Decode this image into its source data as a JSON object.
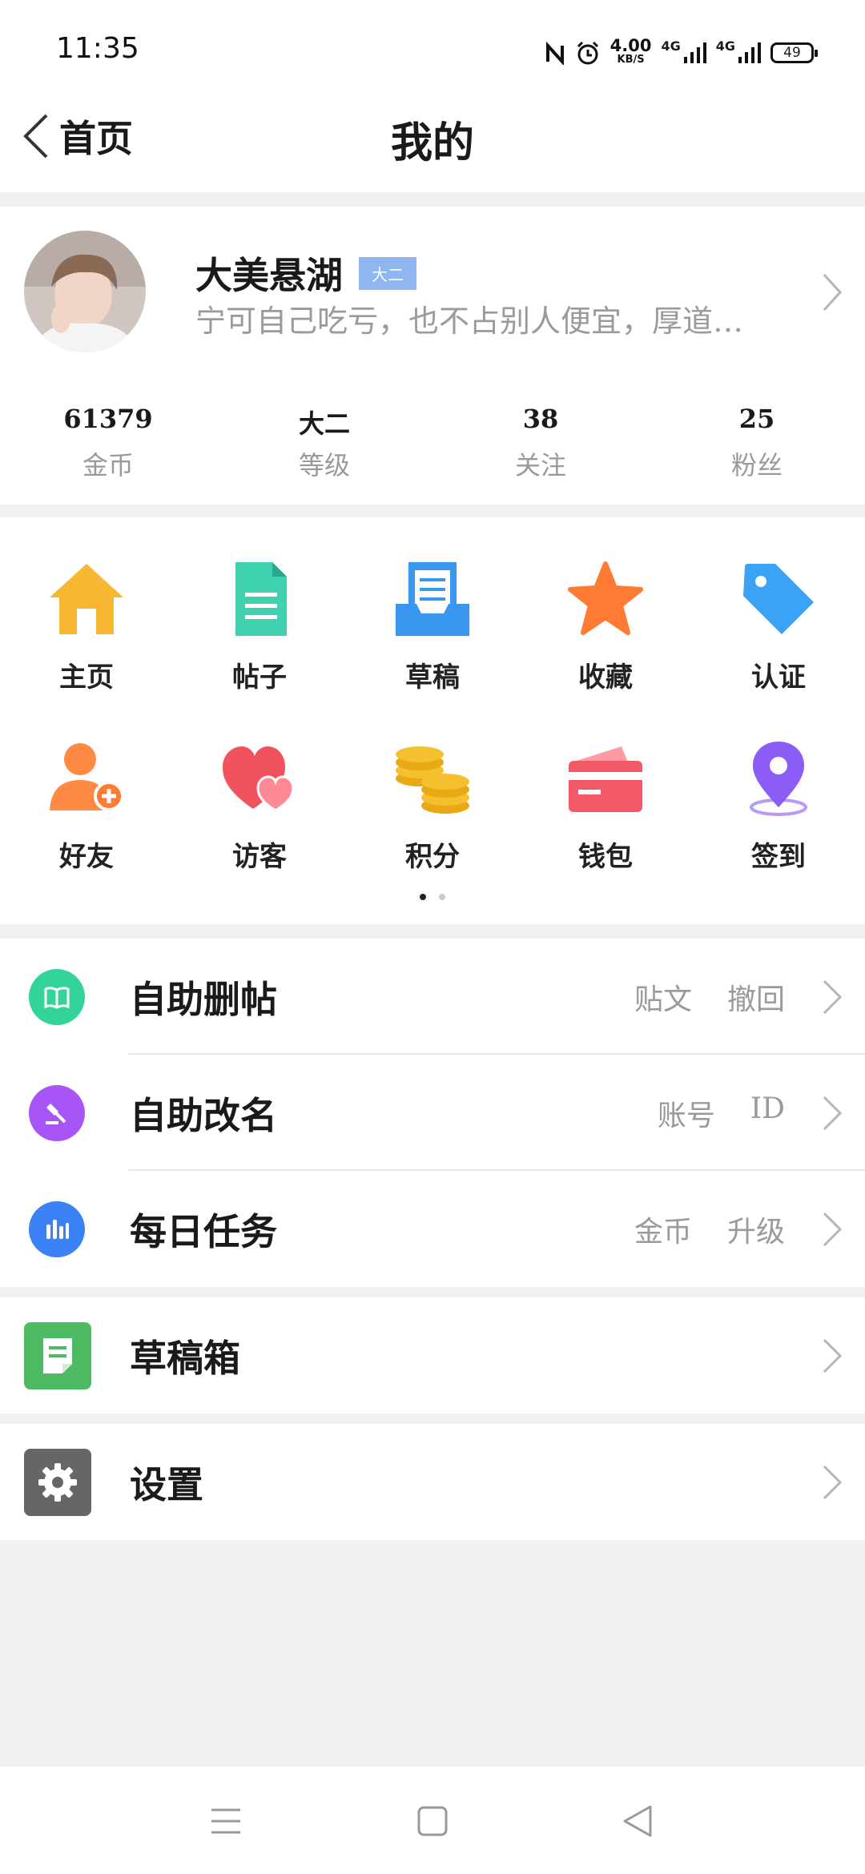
{
  "status_bar": {
    "time": "11:35",
    "speed_value": "4.00",
    "speed_unit": "KB/S",
    "network_1": "4G",
    "network_2": "4G",
    "battery": "49",
    "icons": [
      "nfc-icon",
      "alarm-icon",
      "signal-icon",
      "signal-icon",
      "battery-icon"
    ]
  },
  "header": {
    "back_label": "首页",
    "title": "我的"
  },
  "profile": {
    "name": "大美悬湖",
    "level_badge": "大二",
    "signature": "宁可自己吃亏，也不占别人便宜，厚道…",
    "stats": [
      {
        "value": "61379",
        "label": "金币"
      },
      {
        "value": "大二",
        "label": "等级"
      },
      {
        "value": "38",
        "label": "关注"
      },
      {
        "value": "25",
        "label": "粉丝"
      }
    ]
  },
  "grid": {
    "row1": [
      {
        "label": "主页",
        "icon": "home-icon",
        "color": "#f7b731"
      },
      {
        "label": "帖子",
        "icon": "document-icon",
        "color": "#3fd1b0"
      },
      {
        "label": "草稿",
        "icon": "draft-tray-icon",
        "color": "#3a97f0"
      },
      {
        "label": "收藏",
        "icon": "star-icon",
        "color": "#ff7a33"
      },
      {
        "label": "认证",
        "icon": "tag-icon",
        "color": "#3aa3f5"
      }
    ],
    "row2": [
      {
        "label": "好友",
        "icon": "add-friend-icon",
        "color": "#ff8a45"
      },
      {
        "label": "访客",
        "icon": "hearts-icon",
        "color": "#f0525e"
      },
      {
        "label": "积分",
        "icon": "coins-icon",
        "color": "#f5c02e"
      },
      {
        "label": "钱包",
        "icon": "wallet-icon",
        "color": "#f25a67"
      },
      {
        "label": "签到",
        "icon": "location-pin-icon",
        "color": "#8b5cf6"
      }
    ],
    "page_count": 2,
    "active_page": 1
  },
  "menu_group1": [
    {
      "label": "自助删帖",
      "tags": [
        "贴文",
        "撤回"
      ],
      "icon": "book-icon",
      "color": "#34d399"
    },
    {
      "label": "自助改名",
      "tags": [
        "账号",
        "ID"
      ],
      "icon": "gavel-icon",
      "color": "#a855f7"
    },
    {
      "label": "每日任务",
      "tags": [
        "金币",
        "升级"
      ],
      "icon": "bar-chart-icon",
      "color": "#3b82f6"
    }
  ],
  "menu_group2": [
    {
      "label": "草稿箱",
      "icon": "notepad-icon",
      "color": "#4cbb63"
    }
  ],
  "menu_group3": [
    {
      "label": "设置",
      "icon": "gear-icon",
      "color": "#666666"
    }
  ],
  "nav_bar": {
    "icons": [
      "menu-icon",
      "home-square-icon",
      "back-triangle-icon"
    ]
  }
}
